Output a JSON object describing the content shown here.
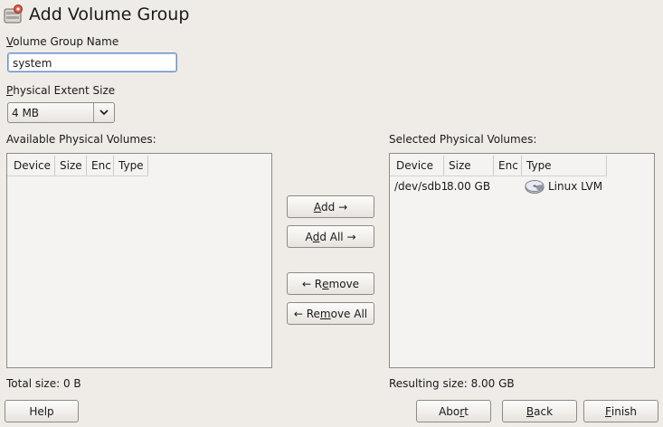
{
  "window": {
    "title": "Add Volume Group"
  },
  "vg_name": {
    "label_key": "V",
    "label_rest": "olume Group Name",
    "value": "system"
  },
  "extent": {
    "label_key": "P",
    "label_rest": "hysical Extent Size",
    "value": "4 MB"
  },
  "available": {
    "label": "Available Physical Volumes:",
    "columns": [
      "Device",
      "Size",
      "Enc",
      "Type"
    ],
    "rows": [],
    "total": "Total size: 0 B"
  },
  "selected": {
    "label": "Selected Physical Volumes:",
    "columns": [
      "Device",
      "Size",
      "Enc",
      "Type"
    ],
    "rows": [
      {
        "device": "/dev/sdb1",
        "size": "8.00 GB",
        "enc": "",
        "type": "Linux LVM",
        "icon": "disk-icon"
      }
    ],
    "result": "Resulting size: 8.00 GB"
  },
  "buttons": {
    "add": {
      "key": "A",
      "rest": "dd →"
    },
    "add_all": {
      "pre": "A",
      "key": "d",
      "rest": "d All →"
    },
    "remove": {
      "pre": "← R",
      "key": "e",
      "rest": "move"
    },
    "remove_all": {
      "pre": "← Re",
      "key": "m",
      "rest": "ove All"
    },
    "help": "Help",
    "abort": {
      "pre": "Abo",
      "key": "r",
      "rest": "t"
    },
    "back": {
      "key": "B",
      "rest": "ack"
    },
    "finish": {
      "key": "F",
      "rest": "inish"
    }
  },
  "colors": {
    "background": "#efebe7",
    "focus_border": "#6d94c4"
  }
}
